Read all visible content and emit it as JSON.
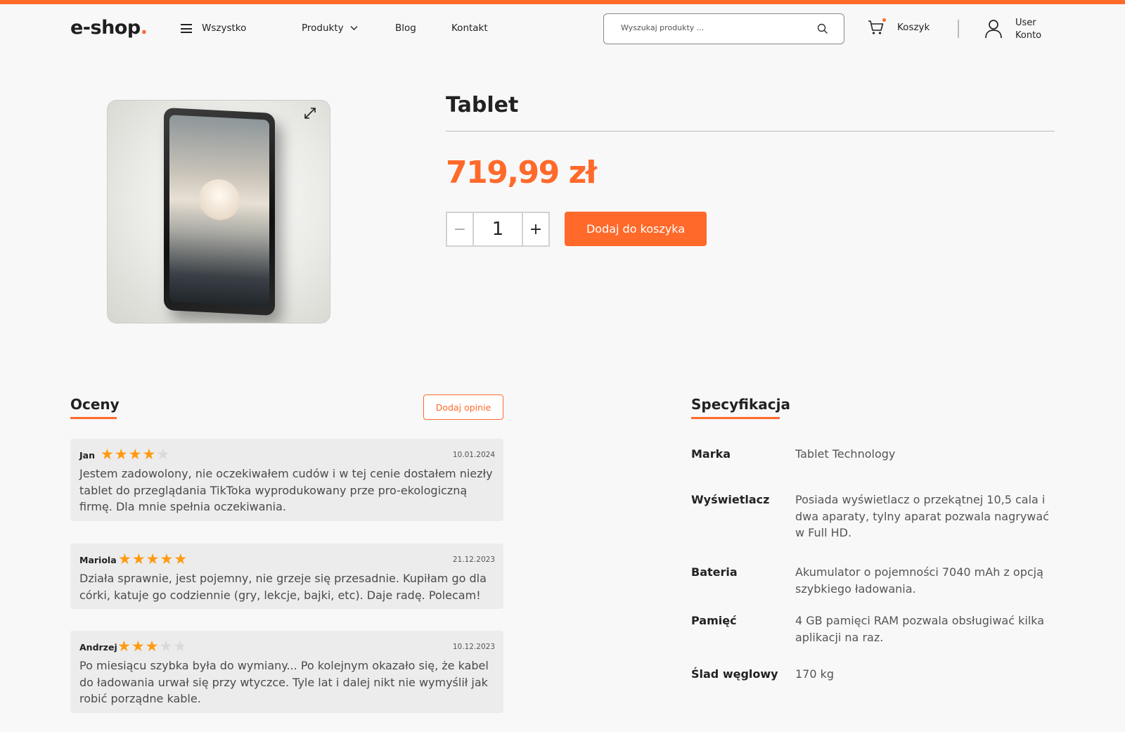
{
  "brand": {
    "logo_main": "e-shop",
    "logo_dot": ".",
    "accent_color": "#ff6a2b"
  },
  "nav": {
    "all_label": "Wszystko",
    "products_label": "Produkty",
    "blog_label": "Blog",
    "contact_label": "Kontakt"
  },
  "search": {
    "placeholder": "Wyszukaj produkty ..."
  },
  "cart": {
    "label": "Koszyk"
  },
  "user": {
    "name": "User",
    "account_label": "Konto"
  },
  "product": {
    "title": "Tablet",
    "price": "719,99 zł",
    "quantity": "1",
    "minus": "−",
    "plus": "+",
    "add_to_cart": "Dodaj do koszyka"
  },
  "reviews": {
    "title": "Oceny",
    "add_button": "Dodaj opinie",
    "items": [
      {
        "name": "Jan",
        "rating": 4,
        "date": "10.01.2024",
        "text": "Jestem zadowolony, nie oczekiwałem cudów i w tej cenie dostałem niezły tablet do przeglądania TikToka wyprodukowany prze pro-ekologiczną firmę. Dla mnie spełnia oczekiwania."
      },
      {
        "name": "Mariola",
        "rating": 5,
        "date": "21.12.2023",
        "text": "Działa sprawnie, jest pojemny, nie grzeje się przesadnie. Kupiłam go dla córki, katuje go codziennie (gry, lekcje, bajki, etc). Daje radę. Polecam!"
      },
      {
        "name": "Andrzej",
        "rating": 3,
        "date": "10.12.2023",
        "text": "Po miesiącu szybka była do wymiany... Po kolejnym okazało się, że kabel do ładowania urwał się przy wtyczce. Tyle lat i dalej nikt nie wymyślił jak robić porządne kable."
      }
    ]
  },
  "specs": {
    "title": "Specyfikacja",
    "items": [
      {
        "key": "Marka",
        "value": "Tablet Technology"
      },
      {
        "key": "Wyświetlacz",
        "value": "Posiada wyświetlacz o przekątnej 10,5 cala i dwa aparaty, tylny aparat pozwala nagrywać w Full HD."
      },
      {
        "key": "Bateria",
        "value": "Akumulator o pojemności 7040 mAh z opcją szybkiego ładowania."
      },
      {
        "key": "Pamięć",
        "value": "4 GB pamięci RAM pozwala obsługiwać kilka aplikacji na raz."
      },
      {
        "key": "Ślad węglowy",
        "value": "170 kg"
      }
    ]
  }
}
